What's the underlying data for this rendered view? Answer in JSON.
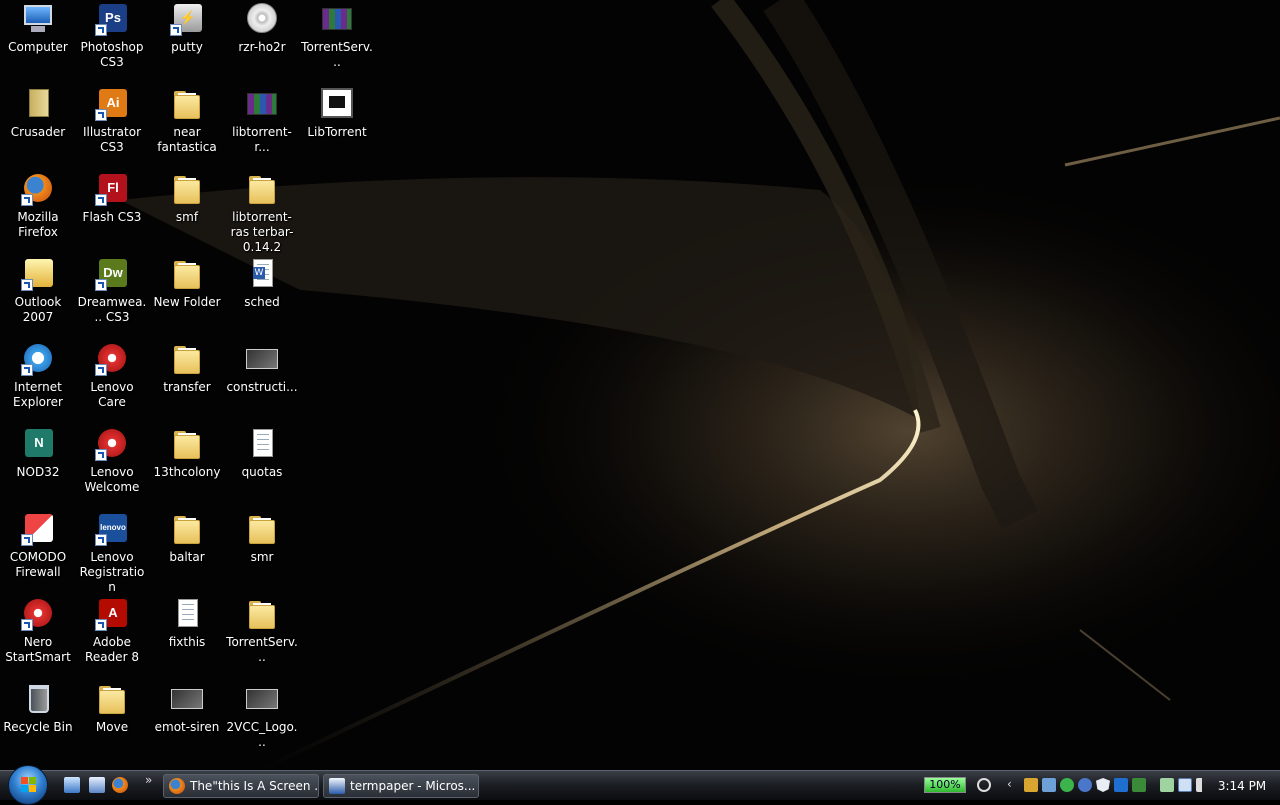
{
  "desktop": {
    "icons": [
      {
        "label": "Computer",
        "icon": "computer-icon"
      },
      {
        "label": "Crusader",
        "icon": "crusader-icon"
      },
      {
        "label": "Mozilla Firefox",
        "icon": "firefox-icon"
      },
      {
        "label": "Outlook 2007",
        "icon": "outlook-icon"
      },
      {
        "label": "Internet Explorer",
        "icon": "internet-explorer-icon"
      },
      {
        "label": "NOD32",
        "icon": "nod32-icon"
      },
      {
        "label": "COMODO Firewall",
        "icon": "comodo-icon"
      },
      {
        "label": "Nero StartSmart",
        "icon": "nero-icon"
      },
      {
        "label": "Recycle Bin",
        "icon": "recycle-bin-icon"
      },
      {
        "label": "Photoshop CS3",
        "icon": "photoshop-icon"
      },
      {
        "label": "Illustrator CS3",
        "icon": "illustrator-icon"
      },
      {
        "label": "Flash CS3",
        "icon": "flash-icon"
      },
      {
        "label": "Dreamwea... CS3",
        "icon": "dreamweaver-icon"
      },
      {
        "label": "Lenovo Care",
        "icon": "lenovo-care-icon"
      },
      {
        "label": "Lenovo Welcome",
        "icon": "lenovo-welcome-icon"
      },
      {
        "label": "Lenovo Registration",
        "icon": "lenovo-registration-icon"
      },
      {
        "label": "Adobe Reader 8",
        "icon": "adobe-reader-icon"
      },
      {
        "label": "Move",
        "icon": "folder-icon"
      },
      {
        "label": "putty",
        "icon": "putty-icon"
      },
      {
        "label": "near fantastica",
        "icon": "folder-icon"
      },
      {
        "label": "smf",
        "icon": "folder-icon"
      },
      {
        "label": "New Folder",
        "icon": "folder-icon"
      },
      {
        "label": "transfer",
        "icon": "folder-icon"
      },
      {
        "label": "13thcolony",
        "icon": "folder-icon"
      },
      {
        "label": "baltar",
        "icon": "folder-icon"
      },
      {
        "label": "fixthis",
        "icon": "text-file-icon"
      },
      {
        "label": "emot-siren",
        "icon": "image-file-icon"
      },
      {
        "label": "rzr-ho2r",
        "icon": "disc-image-icon"
      },
      {
        "label": "libtorrent-r...",
        "icon": "rar-archive-icon"
      },
      {
        "label": "libtorrent-ras terbar-0.14.2",
        "icon": "folder-icon"
      },
      {
        "label": "sched",
        "icon": "word-document-icon"
      },
      {
        "label": "constructi...",
        "icon": "image-file-icon"
      },
      {
        "label": "quotas",
        "icon": "text-file-icon"
      },
      {
        "label": "smr",
        "icon": "folder-icon"
      },
      {
        "label": "TorrentServ...",
        "icon": "folder-icon"
      },
      {
        "label": "2VCC_Logo...",
        "icon": "image-file-icon"
      },
      {
        "label": "TorrentServ...",
        "icon": "rar-archive-icon"
      },
      {
        "label": "LibTorrent",
        "icon": "application-icon"
      }
    ]
  },
  "taskbar": {
    "start_label": "Start",
    "quick_launch": [
      "show-desktop-icon",
      "switch-windows-icon",
      "firefox-icon"
    ],
    "overflow": "»",
    "buttons": [
      {
        "label": "The\"this Is A Screen ...",
        "icon": "firefox-icon"
      },
      {
        "label": "termpaper - Micros...",
        "icon": "word-icon"
      }
    ],
    "tray": {
      "battery": "100%",
      "expand": "‹",
      "clock": "3:14 PM"
    }
  }
}
